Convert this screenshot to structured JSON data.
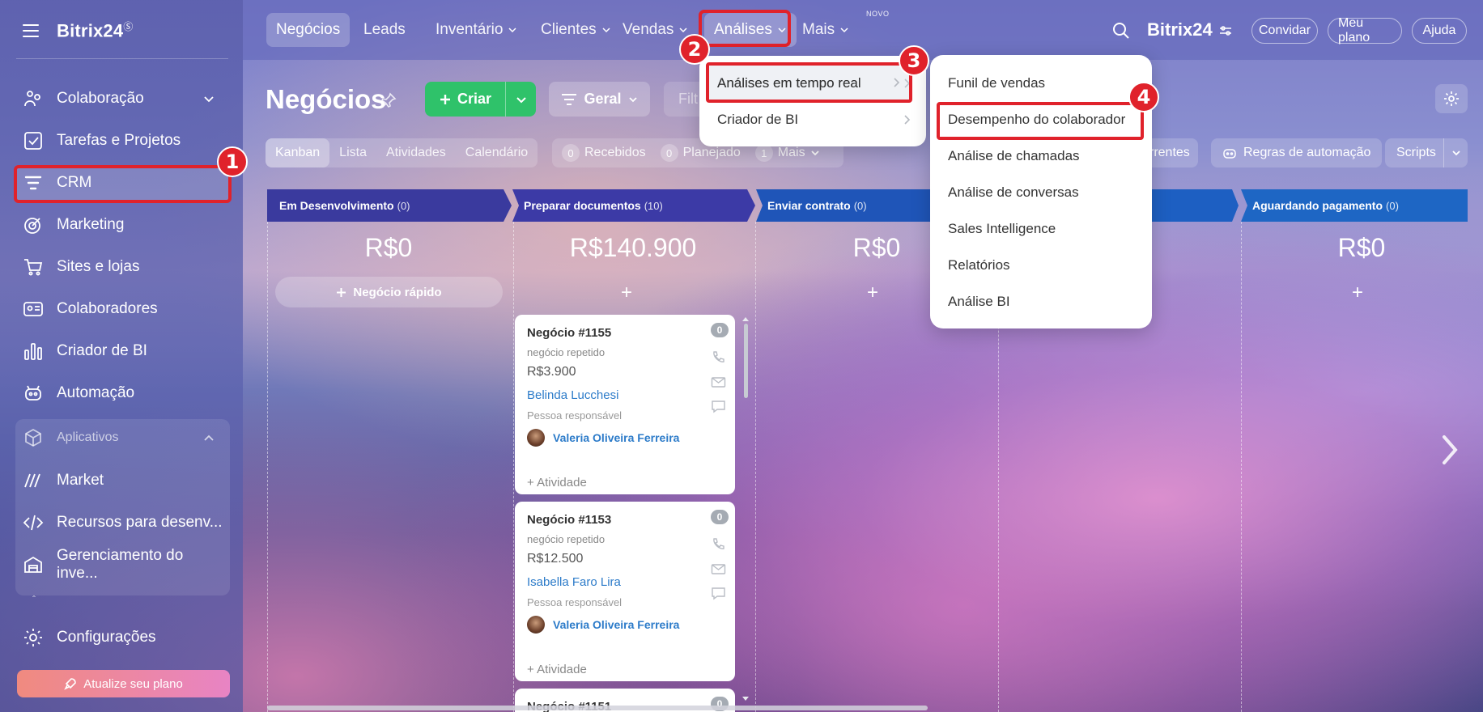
{
  "app": {
    "logo": "Bitrix24",
    "logo_mark": "Ⓢ"
  },
  "sidebar": {
    "items": [
      {
        "label": "Colaboração",
        "icon": "collaboration-icon"
      },
      {
        "label": "Tarefas e Projetos",
        "icon": "tasks-icon"
      },
      {
        "label": "CRM",
        "icon": "crm-funnel-icon"
      },
      {
        "label": "Marketing",
        "icon": "marketing-icon"
      },
      {
        "label": "Sites e lojas",
        "icon": "cart-icon"
      },
      {
        "label": "Colaboradores",
        "icon": "employees-icon"
      },
      {
        "label": "Criador de BI",
        "icon": "bi-chart-icon"
      },
      {
        "label": "Automação",
        "icon": "automation-icon"
      },
      {
        "label": "Aplicativos",
        "icon": "apps-cube-icon"
      },
      {
        "label": "Market",
        "icon": "market-icon"
      },
      {
        "label": "Recursos para desenv...",
        "icon": "code-icon"
      },
      {
        "label": "Gerenciamento do inve...",
        "icon": "inventory-icon"
      },
      {
        "label": "Configurações",
        "icon": "settings-gear-icon"
      }
    ],
    "upgrade_label": "Atualize seu plano"
  },
  "topnav": {
    "tabs": [
      "Negócios",
      "Leads",
      "Inventário",
      "Clientes",
      "Vendas",
      "Análises",
      "Mais"
    ],
    "new_badge": "NOVO",
    "brand": "Bitrix24",
    "invite": "Convidar",
    "my_plan": "Meu plano",
    "help": "Ajuda"
  },
  "toolbar": {
    "title": "Negócios",
    "create": "Criar",
    "pipeline": "Geral",
    "filter_placeholder": "Filt",
    "views": [
      "Kanban",
      "Lista",
      "Atividades",
      "Calendário"
    ],
    "counters": [
      {
        "n": "0",
        "label": "Recebidos"
      },
      {
        "n": "0",
        "label": "Planejado"
      },
      {
        "n": "1",
        "label": "Mais"
      }
    ],
    "recurring_partial": "rrentes",
    "automation_rules": "Regras de automação",
    "scripts": "Scripts"
  },
  "kanban": {
    "columns": [
      {
        "name": "Em Desenvolvimento",
        "count": "(0)",
        "sum": "R$0",
        "color": "#3a3a9e"
      },
      {
        "name": "Preparar documentos",
        "count": "(10)",
        "sum": "R$140.900",
        "color": "#3c3aa6"
      },
      {
        "name": "Enviar contrato",
        "count": "(0)",
        "sum": "R$0",
        "color": "#1f55b8"
      },
      {
        "name": "Aguardando pagamento",
        "count": "(0)",
        "sum": "R$0",
        "color": "#1e66c4"
      }
    ],
    "quick_deal": "Negócio rápido",
    "cards": [
      {
        "title": "Negócio #1155",
        "sub": "negócio repetido",
        "amount": "R$3.900",
        "client": "Belinda Lucchesi",
        "resp_label": "Pessoa responsável",
        "person": "Valeria Oliveira Ferreira",
        "activity": "+ Atividade",
        "badge": "0"
      },
      {
        "title": "Negócio #1153",
        "sub": "negócio repetido",
        "amount": "R$12.500",
        "client": "Isabella Faro Lira",
        "resp_label": "Pessoa responsável",
        "person": "Valeria Oliveira Ferreira",
        "activity": "+ Atividade",
        "badge": "0"
      },
      {
        "title": "Negócio #1151",
        "badge": "0"
      }
    ]
  },
  "analises_menu": {
    "items": [
      "Análises em tempo real",
      "Criador de BI"
    ]
  },
  "realtime_submenu": {
    "items": [
      "Funil de vendas",
      "Desempenho do colaborador",
      "Análise de chamadas",
      "Análise de conversas",
      "Sales Intelligence",
      "Relatórios",
      "Análise BI"
    ]
  },
  "markers": [
    "1",
    "2",
    "3",
    "4"
  ],
  "colors": {
    "highlight": "#e0222b",
    "create": "#2fc26a",
    "link": "#2c7bc9"
  }
}
